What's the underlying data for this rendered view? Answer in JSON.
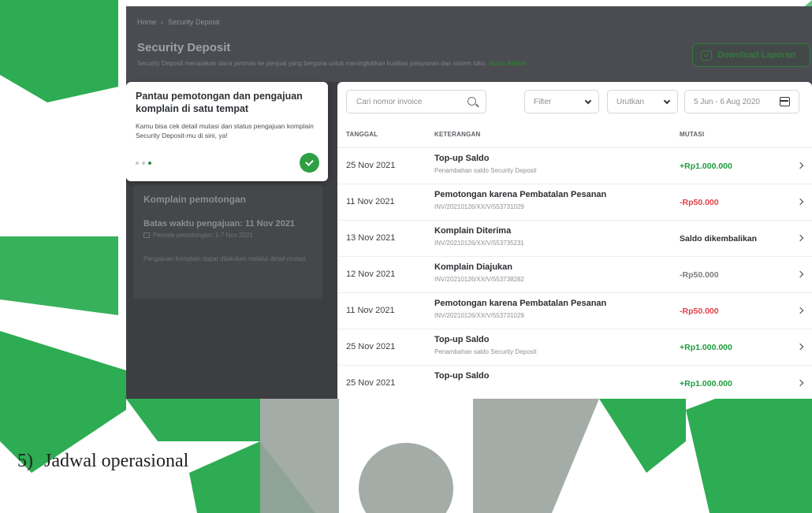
{
  "colors": {
    "accent": "#2e8b3e",
    "plus": "#1e9b3e",
    "minus": "#e0404a",
    "neutral": "#2b2e32",
    "muted": "#7b7e82"
  },
  "breadcrumb": {
    "home": "Home",
    "current": "Security Deposit"
  },
  "page": {
    "title": "Security Deposit",
    "subtitle": "Security Deposit merupakan dana jaminan ke penjual yang berguna untuk meningkatkan kualitas pelayanan dan sistem toko.",
    "read_more": "Baca Artikel",
    "download_label": "Download Laporan"
  },
  "tooltip": {
    "title": "Pantau pemotongan dan pengajuan komplain di satu tempat",
    "body": "Kamu bisa cek detail mutasi dan status pengajuan komplain Security Deposit-mu di sini, ya!",
    "step": 3,
    "total_steps": 3
  },
  "complaint": {
    "title": "Komplain pemotongan",
    "deadline": "Batas waktu pengajuan: 11 Nov 2021",
    "period": "Periode pemotongan: 1-7 Nov 2021",
    "note": "Pengajuan komplain dapat dilakukan melalui detail mutasi."
  },
  "filters": {
    "search_placeholder": "Cari nomor invoice",
    "filter_label": "Filter",
    "sort_label": "Urutkan",
    "date_range": "5 Jun - 6 Aug 2020"
  },
  "table": {
    "headers": {
      "date": "TANGGAL",
      "desc": "KETERANGAN",
      "mutation": "MUTASI"
    },
    "rows": [
      {
        "date": "25 Nov 2021",
        "title": "Top-up Saldo",
        "sub": "Penambahan saldo Security Deposit",
        "amount": "+Rp1.000.000",
        "kind": "plus"
      },
      {
        "date": "11 Nov 2021",
        "title": "Pemotongan karena Pembatalan Pesanan",
        "sub": "INV/20210126/XX/V/553731029",
        "amount": "-Rp50.000",
        "kind": "minus"
      },
      {
        "date": "13 Nov 2021",
        "title": "Komplain Diterima",
        "sub": "INV/20210126/XX/V/553735231",
        "amount": "Saldo dikembalikan",
        "kind": "neutral"
      },
      {
        "date": "12 Nov 2021",
        "title": "Komplain Diajukan",
        "sub": "INV/20210126/XX/V/553738282",
        "amount": "-Rp50.000",
        "kind": "muted"
      },
      {
        "date": "11 Nov 2021",
        "title": "Pemotongan karena Pembatalan Pesanan",
        "sub": "INV/20210126/XX/V/553731029",
        "amount": "-Rp50.000",
        "kind": "minus"
      },
      {
        "date": "25 Nov 2021",
        "title": "Top-up Saldo",
        "sub": "Penambahan saldo Security Deposit",
        "amount": "+Rp1.000.000",
        "kind": "plus"
      },
      {
        "date": "25 Nov 2021",
        "title": "Top-up Saldo",
        "sub": "",
        "amount": "+Rp1.000.000",
        "kind": "plus"
      }
    ]
  },
  "caption": {
    "number": "5)",
    "text": "Jadwal operasional"
  }
}
